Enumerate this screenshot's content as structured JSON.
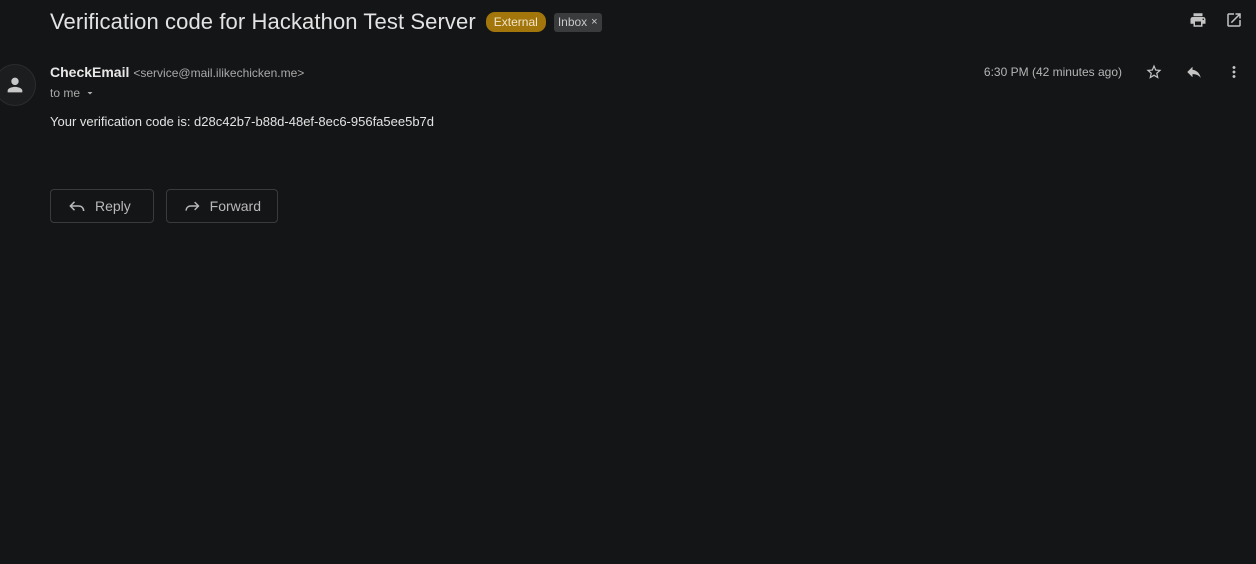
{
  "email": {
    "subject": "Verification code for Hackathon Test Server",
    "labels": {
      "external": "External",
      "inbox": "Inbox",
      "inbox_remove": "×"
    },
    "sender": {
      "name": "CheckEmail",
      "email": "<service@mail.ilikechicken.me>"
    },
    "recipient_line": "to me",
    "timestamp": "6:30 PM (42 minutes ago)",
    "body": "Your verification code is: d28c42b7-b88d-48ef-8ec6-956fa5ee5b7d"
  },
  "actions": {
    "reply_label": "Reply",
    "forward_label": "Forward"
  },
  "icons": {
    "print": "print-icon",
    "open_new_window": "open-in-new-icon",
    "star": "star-icon",
    "reply": "reply-icon",
    "more": "more-vert-icon",
    "avatar": "person-icon",
    "dropdown": "caret-down-icon",
    "forward": "forward-icon"
  },
  "colors": {
    "background": "#141517",
    "external_badge": "#a3760c",
    "inbox_badge": "#3a3b3d",
    "text": "#e3e3e3"
  }
}
